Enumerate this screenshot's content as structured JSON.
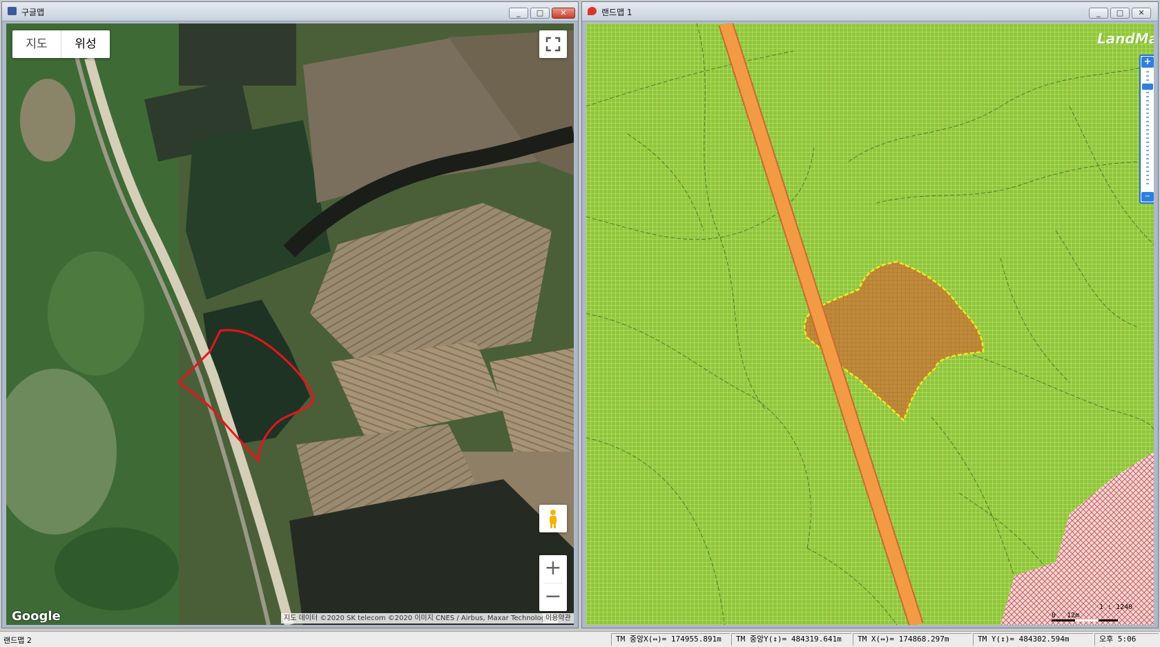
{
  "google_window": {
    "title": "구글맵",
    "map_type_options": [
      "지도",
      "위성"
    ],
    "selected_map_type": "위성",
    "logo": "Google",
    "attribution": "지도 데이터 ©2020 SK telecom ©2020 이미지 CNES / Airbus, Maxar Technologies",
    "terms": "이용약관",
    "zoom_in": "+",
    "zoom_out": "−",
    "outline_color": "#e8141c"
  },
  "land_window": {
    "title": "랜드맵 1",
    "logo": "LandMap",
    "zoom_in": "+",
    "zoom_out": "−",
    "scale_ratio": "1 : 1240",
    "scale_zero": "0",
    "scale_distance": "12m",
    "parcel_fill": "#8cc63f",
    "road_color": "#f39a45",
    "highlight_color": "#c08a3a",
    "highlight_border": "#f5ea1a",
    "restricted_color": "#f2c9c9"
  },
  "window_controls": {
    "minimize": "_",
    "maximize": "□",
    "close": "✕"
  },
  "statusbar": {
    "left": "랜드맵 2",
    "center_x": "TM 중앙X(↔)= 174955.891m",
    "center_y": "TM 중앙Y(↕)= 484319.641m",
    "tm_x": "TM X(↔)= 174868.297m",
    "tm_y": "TM Y(↕)= 484302.594m",
    "time": "오후 5:06"
  }
}
